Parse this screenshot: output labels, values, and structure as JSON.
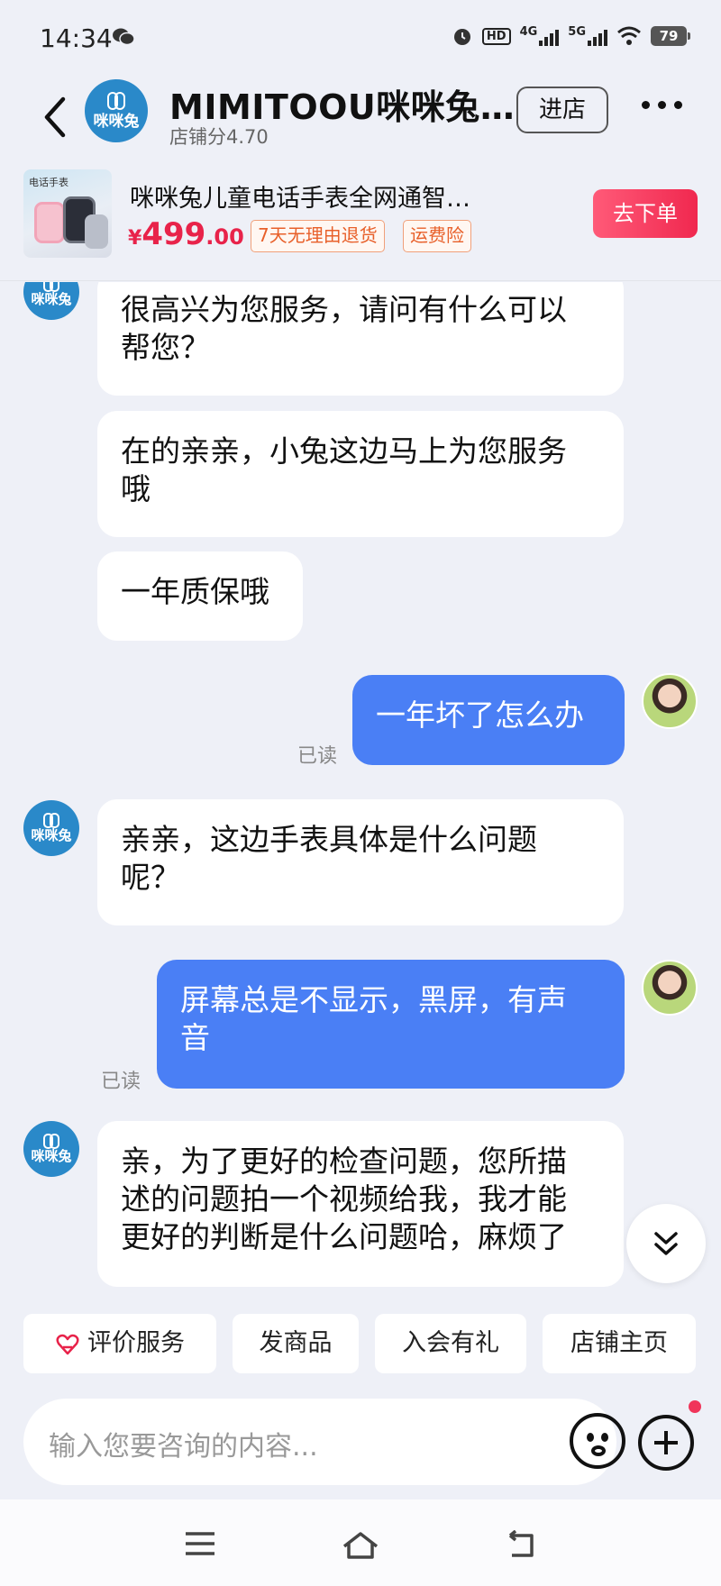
{
  "status_bar": {
    "time": "14:34",
    "net1": "HD",
    "net2": "4G",
    "net3": "5G",
    "battery": "79"
  },
  "shop": {
    "logo_text": "咪咪兔",
    "name": "MIMITOOU咪咪兔…",
    "score": "店铺分4.70",
    "enter_label": "进店"
  },
  "product": {
    "thumb_caption": "电话手表",
    "title": "咪咪兔儿童电话手表全网通智…",
    "price_symbol": "¥",
    "price_int": "499",
    "price_dec": ".00",
    "tags": [
      "7天无理由退货",
      "运费险"
    ],
    "order_label": "去下单"
  },
  "messages": [
    {
      "from": "shop",
      "text_lines": [
        "很高兴为您服务，请问有什么可以",
        "帮您？"
      ]
    },
    {
      "from": "shop",
      "text_lines": [
        "在的亲亲，小兔这边马上为您服务",
        "哦"
      ]
    },
    {
      "from": "shop",
      "text_lines": [
        "一年质保哦"
      ]
    },
    {
      "from": "user",
      "text_lines": [
        "一年坏了怎么办"
      ],
      "read": "已读"
    },
    {
      "from": "shop",
      "text_lines": [
        "亲亲，这边手表具体是什么问题",
        "呢？"
      ]
    },
    {
      "from": "user",
      "text_lines": [
        "屏幕总是不显示，黑屏，有声",
        "音"
      ],
      "read": "已读"
    },
    {
      "from": "shop",
      "text_lines": [
        "亲，为了更好的检查问题，您所描",
        "述的问题拍一个视频给我，我才能",
        "更好的判断是什么问题哈，麻烦了"
      ]
    }
  ],
  "quick_actions": [
    "评价服务",
    "发商品",
    "入会有礼",
    "店铺主页"
  ],
  "input": {
    "placeholder": "输入您要咨询的内容..."
  },
  "colors": {
    "brand_blue": "#2a89c9",
    "user_bubble": "#4a7ff5",
    "price_red": "#e8234a",
    "order_button": "#f0284f",
    "background": "#eef0f7"
  },
  "icons": [
    "wechat-icon",
    "alarm-icon",
    "wifi-icon",
    "back-icon",
    "more-icon",
    "heart-icon",
    "emoji-icon",
    "plus-icon",
    "chevron-double-down-icon",
    "menu-icon",
    "home-icon",
    "back-nav-icon"
  ]
}
